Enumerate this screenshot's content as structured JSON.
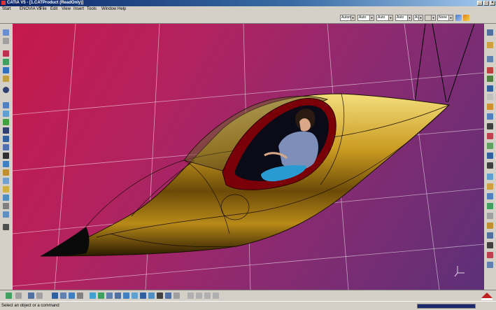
{
  "window": {
    "title": "CATIA V5 - [1.CATProduct (ReadOnly)]"
  },
  "menu": [
    "Start",
    "ENOVIA V5",
    "File",
    "Edit",
    "View",
    "Insert",
    "Tools",
    "Window",
    "Help"
  ],
  "toolbar_combos": [
    "Automa",
    "Auto",
    "Auto",
    "Auto",
    "Aut",
    "",
    "None"
  ],
  "status": {
    "message": "Select an object or a command"
  },
  "icons": {
    "left": [
      "wrench-icon",
      "pin-icon",
      "sketch-icon",
      "pad-icon",
      "pocket-icon",
      "shaft-icon",
      "spiral-icon",
      "gear-icon",
      "assembly-icon",
      "constraint-icon",
      "table-icon",
      "grid-icon",
      "cube-icon",
      "lamp-icon",
      "scene-icon",
      "render-icon",
      "camera-icon",
      "light-icon",
      "axis-icon",
      "measure-icon",
      "brush-icon",
      "ruler-icon"
    ],
    "right": [
      "sketcher-icon",
      "plane-icon",
      "line-icon",
      "point-icon",
      "fix-icon",
      "product-icon",
      "part-icon",
      "move-icon",
      "snap-icon",
      "explode-icon",
      "clash-icon",
      "section-icon",
      "distance-icon",
      "annotation-icon",
      "scene-icon",
      "viewpoint-icon",
      "light-icon",
      "environment-icon",
      "turntable-icon",
      "render-icon",
      "shooting-icon",
      "catalog-icon",
      "material-icon",
      "texture-icon"
    ],
    "bottom": [
      "undo-icon",
      "redo-icon",
      "fog-icon",
      "zoom-window-icon",
      "fit-all-icon",
      "pan-icon",
      "rotate-icon",
      "zoom-in-icon",
      "zoom-out-icon",
      "normal-view-icon",
      "iso-view-icon",
      "shading-icon",
      "hide-icon",
      "swap-icon",
      "layer-icon"
    ]
  },
  "colors": {
    "hull": "#c9a227",
    "frame": "#8b0000",
    "background_top": "#c5194c",
    "background_bottom": "#5c3077"
  }
}
